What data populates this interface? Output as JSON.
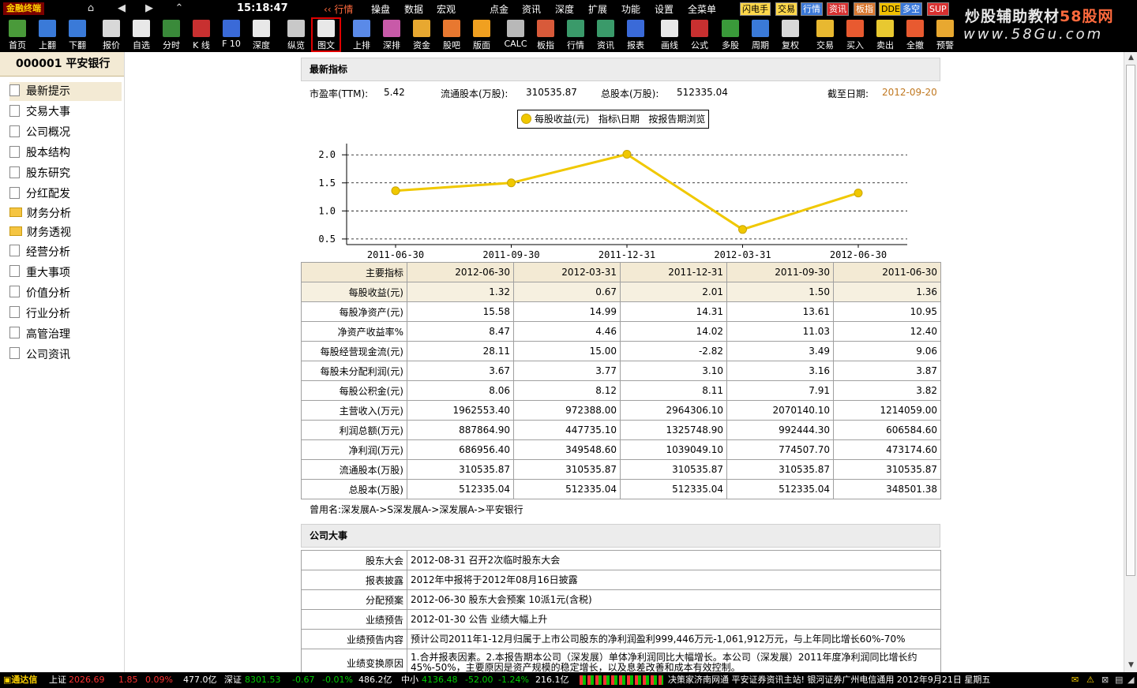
{
  "window": {
    "app_title": "金融终端",
    "clock": "15:18:47",
    "back_label": "行情"
  },
  "menu": [
    "操盘",
    "数据",
    "宏观",
    "点金",
    "资讯",
    "深度",
    "扩展",
    "功能",
    "设置",
    "全菜单"
  ],
  "badges": [
    {
      "label": "闪电手",
      "bg": "#ffd84a",
      "fg": "#000000"
    },
    {
      "label": "交易",
      "bg": "#ffd84a",
      "fg": "#000000"
    },
    {
      "label": "行情",
      "bg": "#3a78d8",
      "fg": "#ffffff"
    },
    {
      "label": "资讯",
      "bg": "#d83030",
      "fg": "#ffffff"
    },
    {
      "label": "板指",
      "bg": "#d87830",
      "fg": "#ffffff"
    },
    {
      "label": "DDE",
      "bg": "#f0c000",
      "fg": "#000000"
    },
    {
      "label": "多空",
      "bg": "#3a78d8",
      "fg": "#ffffff"
    },
    {
      "label": "SUP",
      "bg": "#d83030",
      "fg": "#ffffff"
    }
  ],
  "brand": {
    "cn_prefix": "炒股辅助教材",
    "cn_highlight": "58股网",
    "url": "www.58Gu.com"
  },
  "toolbar": [
    {
      "label": "首页",
      "icon": "home-icon",
      "color": "#4a9a3a"
    },
    {
      "label": "上翻",
      "icon": "arrow-up-icon",
      "color": "#3a7ad8"
    },
    {
      "label": "下翻",
      "icon": "arrow-down-icon",
      "color": "#3a7ad8"
    },
    {
      "label": "报价",
      "icon": "yen-icon",
      "color": "#d8d8d8"
    },
    {
      "label": "自选",
      "icon": "f6-icon",
      "color": "#e8e8e8"
    },
    {
      "label": "分时",
      "icon": "intraday-icon",
      "color": "#3a8a3a"
    },
    {
      "label": "K 线",
      "icon": "kline-icon",
      "color": "#c83030"
    },
    {
      "label": "F 10",
      "icon": "f10-icon",
      "color": "#3a6ad8"
    },
    {
      "label": "深度",
      "icon": "f9-icon",
      "color": "#e8e8e8"
    },
    {
      "label": "纵览",
      "icon": "overview-icon",
      "color": "#c8c8c8"
    },
    {
      "label": "图文",
      "icon": "chart-text-icon",
      "color": "#e8e8e8"
    },
    {
      "label": "上排",
      "icon": "rank-up-icon",
      "color": "#5a8ae8"
    },
    {
      "label": "深排",
      "icon": "rank-sz-icon",
      "color": "#c85aa8"
    },
    {
      "label": "资金",
      "icon": "funds-icon",
      "color": "#e8a830"
    },
    {
      "label": "股吧",
      "icon": "forum-icon",
      "color": "#e87830"
    },
    {
      "label": "版面",
      "icon": "l2-icon",
      "color": "#f0a020"
    },
    {
      "label": "CALC",
      "icon": "calculator-icon",
      "color": "#b8b8b8"
    },
    {
      "label": "板指",
      "icon": "sector-icon",
      "color": "#d85a3a"
    },
    {
      "label": "行情",
      "icon": "market-icon",
      "color": "#3a9a6a"
    },
    {
      "label": "资讯",
      "icon": "news-icon",
      "color": "#3a9a6a"
    },
    {
      "label": "报表",
      "icon": "report-icon",
      "color": "#3a6ad8"
    },
    {
      "label": "画线",
      "icon": "draw-line-icon",
      "color": "#e8e8e8"
    },
    {
      "label": "公式",
      "icon": "formula-icon",
      "color": "#c83030"
    },
    {
      "label": "多股",
      "icon": "multi-stock-icon",
      "color": "#3a9a3a"
    },
    {
      "label": "周期",
      "icon": "period-icon",
      "color": "#3a7ad8"
    },
    {
      "label": "复权",
      "icon": "restore-icon",
      "color": "#d8d8d8"
    },
    {
      "label": "交易",
      "icon": "trade-icon",
      "color": "#e8b830"
    },
    {
      "label": "买入",
      "icon": "buy-icon",
      "color": "#e85a30"
    },
    {
      "label": "卖出",
      "icon": "sell-icon",
      "color": "#e8c830"
    },
    {
      "label": "全撤",
      "icon": "cancel-all-icon",
      "color": "#e85a30"
    },
    {
      "label": "预警",
      "icon": "alert-icon",
      "color": "#e8a830"
    }
  ],
  "sidebar": {
    "stock": "000001  平安银行",
    "items": [
      {
        "label": "最新提示",
        "type": "doc",
        "selected": true
      },
      {
        "label": "交易大事",
        "type": "doc"
      },
      {
        "label": "公司概况",
        "type": "doc"
      },
      {
        "label": "股本结构",
        "type": "doc"
      },
      {
        "label": "股东研究",
        "type": "doc"
      },
      {
        "label": "分红配发",
        "type": "doc"
      },
      {
        "label": "财务分析",
        "type": "folder"
      },
      {
        "label": "财务透视",
        "type": "folder"
      },
      {
        "label": "经营分析",
        "type": "doc"
      },
      {
        "label": "重大事项",
        "type": "doc"
      },
      {
        "label": "价值分析",
        "type": "doc"
      },
      {
        "label": "行业分析",
        "type": "doc"
      },
      {
        "label": "高管治理",
        "type": "doc"
      },
      {
        "label": "公司资讯",
        "type": "doc"
      }
    ]
  },
  "latest": {
    "header": "最新指标",
    "pe_label": "市盈率(TTM):",
    "pe_value": "5.42",
    "float_label": "流通股本(万股):",
    "float_value": "310535.87",
    "total_label": "总股本(万股):",
    "total_value": "512335.04",
    "date_label": "截至日期:",
    "date_value": "2012-09-20"
  },
  "legend": {
    "series": "每股收益(元)",
    "axis": "指标\\日期",
    "browse": "按报告期浏览"
  },
  "chart_data": {
    "type": "line",
    "x": [
      "2011-06-30",
      "2011-09-30",
      "2011-12-31",
      "2012-03-31",
      "2012-06-30"
    ],
    "series": [
      {
        "name": "每股收益(元)",
        "values": [
          1.36,
          1.5,
          2.01,
          0.67,
          1.32
        ],
        "color": "#f0c800"
      }
    ],
    "yticks": [
      "2.0",
      "1.5",
      "1.0",
      "0.5"
    ],
    "ylim": [
      0.4,
      2.2
    ],
    "grid": true,
    "legend_position": "top-center"
  },
  "indicators": {
    "header_label": "主要指标",
    "dates": [
      "2012-06-30",
      "2012-03-31",
      "2011-12-31",
      "2011-09-30",
      "2011-06-30"
    ],
    "rows": [
      {
        "label": "每股收益(元)",
        "values": [
          "1.32",
          "0.67",
          "2.01",
          "1.50",
          "1.36"
        ]
      },
      {
        "label": "每股净资产(元)",
        "values": [
          "15.58",
          "14.99",
          "14.31",
          "13.61",
          "10.95"
        ]
      },
      {
        "label": "净资产收益率%",
        "values": [
          "8.47",
          "4.46",
          "14.02",
          "11.03",
          "12.40"
        ]
      },
      {
        "label": "每股经营现金流(元)",
        "values": [
          "28.11",
          "15.00",
          "-2.82",
          "3.49",
          "9.06"
        ]
      },
      {
        "label": "每股未分配利润(元)",
        "values": [
          "3.67",
          "3.77",
          "3.10",
          "3.16",
          "3.87"
        ]
      },
      {
        "label": "每股公积金(元)",
        "values": [
          "8.06",
          "8.12",
          "8.11",
          "7.91",
          "3.82"
        ]
      },
      {
        "label": "主营收入(万元)",
        "values": [
          "1962553.40",
          "972388.00",
          "2964306.10",
          "2070140.10",
          "1214059.00"
        ]
      },
      {
        "label": "利润总额(万元)",
        "values": [
          "887864.90",
          "447735.10",
          "1325748.90",
          "992444.30",
          "606584.60"
        ]
      },
      {
        "label": "净利润(万元)",
        "values": [
          "686956.40",
          "349548.60",
          "1039049.10",
          "774507.70",
          "473174.60"
        ]
      },
      {
        "label": "流通股本(万股)",
        "values": [
          "310535.87",
          "310535.87",
          "310535.87",
          "310535.87",
          "310535.87"
        ]
      },
      {
        "label": "总股本(万股)",
        "values": [
          "512335.04",
          "512335.04",
          "512335.04",
          "512335.04",
          "348501.38"
        ]
      }
    ]
  },
  "former_name": "曾用名:深发展A->S深发展A->深发展A->平安银行",
  "events": {
    "header": "公司大事",
    "rows": [
      {
        "label": "股东大会",
        "value": "2012-08-31  召开2次临时股东大会"
      },
      {
        "label": "报表披露",
        "value": "2012年中报将于2012年08月16日披露"
      },
      {
        "label": "分配预案",
        "value": "2012-06-30  股东大会预案  10派1元(含税)"
      },
      {
        "label": "业绩预告",
        "value": "2012-01-30  公告  业绩大幅上升"
      },
      {
        "label": "业绩预告内容",
        "value": "预计公司2011年1-12月归属于上市公司股东的净利润盈利999,446万元-1,061,912万元，与上年同比增长60%-70%"
      },
      {
        "label": "业绩变换原因",
        "value": "1.合并报表因素。2.本报告期本公司（深发展）单体净利润同比大幅增长。本公司（深发展）2011年度净利润同比增长约45%-50%，主要原因是资产规模的稳定增长，以及息差改善和成本有效控制。"
      }
    ]
  },
  "statusbar": {
    "app": "通达信",
    "sh_label": "上证",
    "sh_index": "2026.69",
    "sh_change": "1.85",
    "sh_pct": "0.09%",
    "sh_vol": "477.0亿",
    "sz_label": "深证",
    "sz_index": "8301.53",
    "sz_change": "-0.67",
    "sz_pct": "-0.01%",
    "sz_vol": "486.2亿",
    "zx_label": "中小",
    "zx_index": "4136.48",
    "zx_change": "-52.00",
    "zx_pct": "-1.24%",
    "zx_vol": "216.1亿",
    "ticker": "决策家济南网通  平安证券资讯主站! 银河证券广州电信通用 2012年9月21日 星期五"
  }
}
